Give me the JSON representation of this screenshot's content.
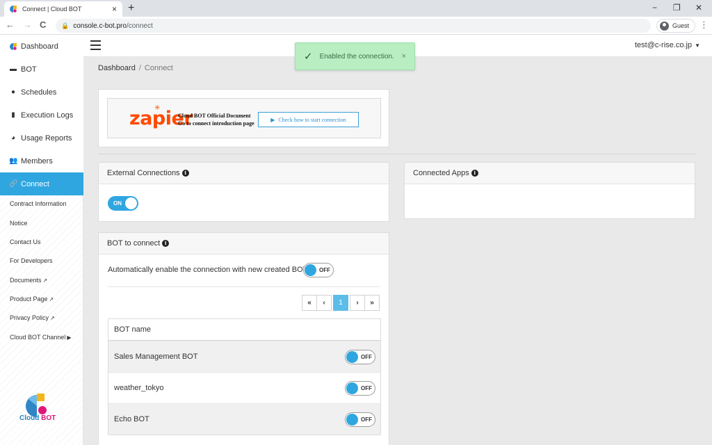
{
  "browser": {
    "tab_title": "Connect | Cloud BOT",
    "tab_close": "×",
    "new_tab": "+",
    "minimize": "−",
    "restore": "❐",
    "close": "✕",
    "back": "←",
    "forward": "→",
    "reload": "C",
    "url_domain": "console.c-bot.pro",
    "url_path": "/connect",
    "profile_label": "Guest",
    "menu": "⋮"
  },
  "sidebar": {
    "items": [
      {
        "label": "Dashboard",
        "icon": "cloudbot-logo-icon"
      },
      {
        "label": "BOT",
        "icon": "bot-icon"
      },
      {
        "label": "Schedules",
        "icon": "clock-icon"
      },
      {
        "label": "Execution Logs",
        "icon": "file-icon"
      },
      {
        "label": "Usage Reports",
        "icon": "pie-chart-icon"
      },
      {
        "label": "Members",
        "icon": "users-icon"
      },
      {
        "label": "Connect",
        "icon": "link-icon",
        "active": true
      }
    ],
    "sub_items": [
      {
        "label": "Contract Information"
      },
      {
        "label": "Notice"
      },
      {
        "label": "Contact Us"
      },
      {
        "label": "For Developers"
      },
      {
        "label": "Documents",
        "icon": "external-link-icon"
      },
      {
        "label": "Product Page",
        "icon": "external-link-icon"
      },
      {
        "label": "Privacy Policy",
        "icon": "external-link-icon"
      },
      {
        "label": "Cloud BOT Channel",
        "icon": "youtube-icon"
      }
    ],
    "logo_text_a": "Cloud",
    "logo_text_b": "BOT"
  },
  "header": {
    "user_email": "test@c-rise.co.jp"
  },
  "breadcrumb": {
    "root": "Dashboard",
    "separator": "/",
    "current": "Connect"
  },
  "toast": {
    "message": "Enabled the connection.",
    "close": "×"
  },
  "zapier": {
    "logo": "zapier",
    "doc_line1": "Cloud BOT Official Document",
    "doc_line2": "Go to connect introduction page",
    "button_label": "Check how to start connection"
  },
  "external_connections": {
    "title": "External Connections",
    "toggle_label": "ON",
    "enabled": true
  },
  "connected_apps": {
    "title": "Connected Apps"
  },
  "bot_to_connect": {
    "title": "BOT to connect",
    "auto_enable_text": "Automatically enable the connection with new created BOT.",
    "auto_toggle_label": "OFF",
    "pagination": {
      "first": "«",
      "prev": "‹",
      "current_page": "1",
      "next": "›",
      "last": "»"
    },
    "table": {
      "column_header": "BOT name",
      "rows": [
        {
          "name": "Sales Management BOT",
          "toggle": "OFF"
        },
        {
          "name": "weather_tokyo",
          "toggle": "OFF"
        },
        {
          "name": "Echo BOT",
          "toggle": "OFF"
        }
      ]
    }
  },
  "colors": {
    "accent": "#2fa6e0",
    "toast_bg": "#b9eec2",
    "zapier_orange": "#ff4a00"
  }
}
